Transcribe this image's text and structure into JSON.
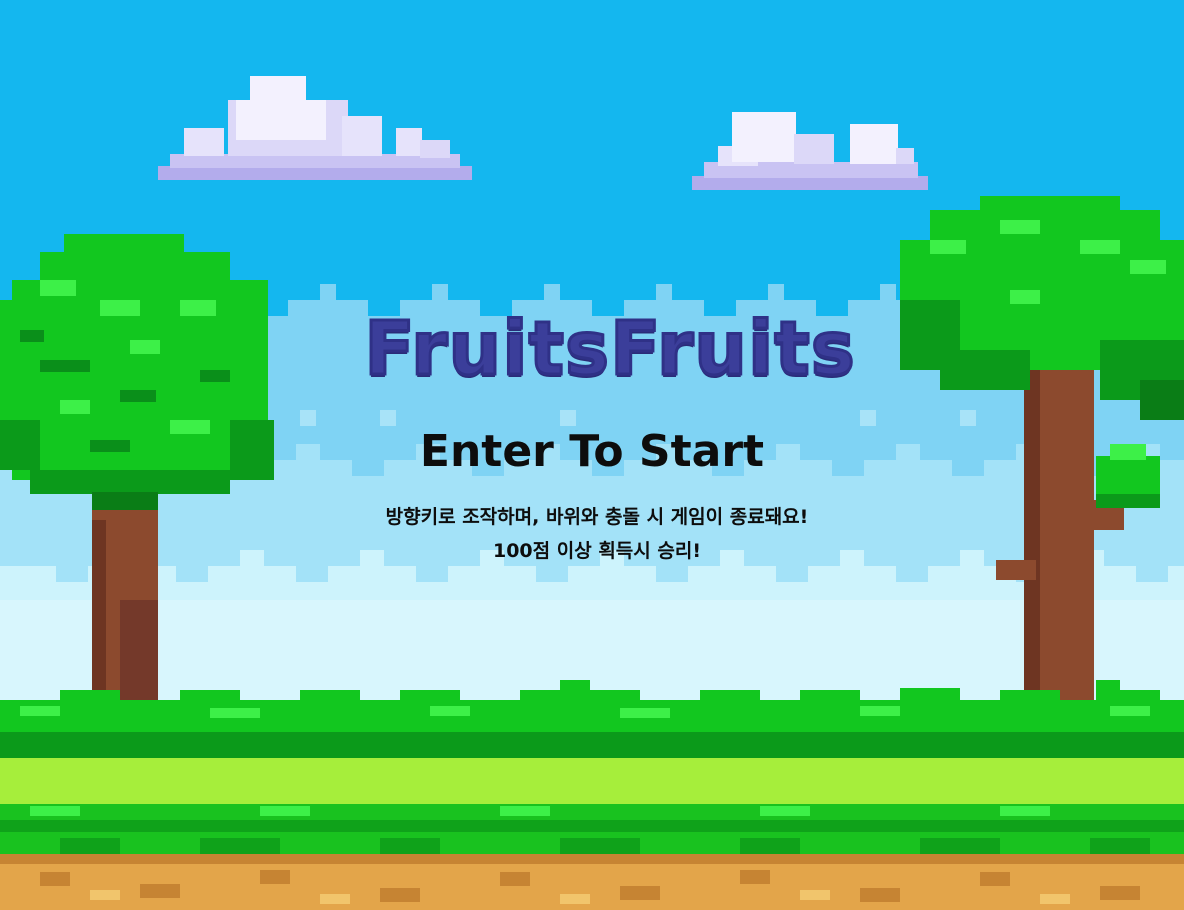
{
  "game": {
    "title": "FruitsFruits",
    "start_prompt": "Enter To Start",
    "instructions": [
      "방향키로 조작하며, 바위와 충돌 시 게임이 종료돼요!",
      "100점 이상 획득시 승리!"
    ]
  },
  "colors": {
    "sky": "#14b7ef",
    "title": "#3b3e9a",
    "text": "#0d0d0d",
    "leaf": "#12d12a",
    "leaf_dark": "#0a8f1a",
    "trunk": "#8c4a2e",
    "grass": "#a6ee3b",
    "dirt": "#e3a54a"
  }
}
